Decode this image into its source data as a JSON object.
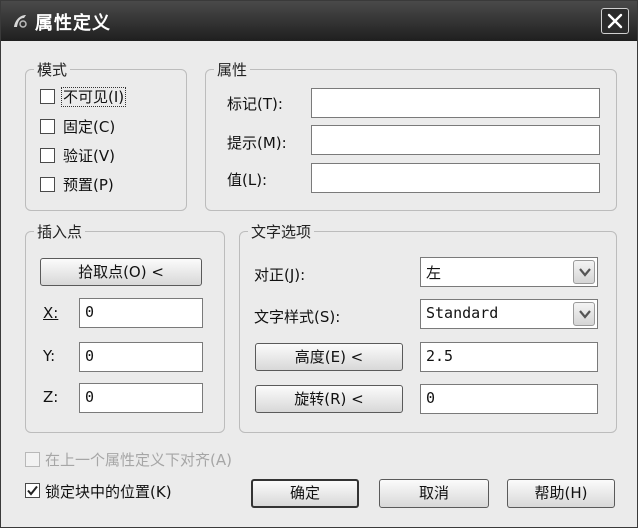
{
  "window": {
    "title": "属性定义"
  },
  "mode": {
    "legend": "模式",
    "items": [
      {
        "label": "不可见(I)",
        "checked": false
      },
      {
        "label": "固定(C)",
        "checked": false
      },
      {
        "label": "验证(V)",
        "checked": false
      },
      {
        "label": "预置(P)",
        "checked": false
      }
    ]
  },
  "attributes": {
    "legend": "属性",
    "tag_label": "标记(T):",
    "tag_value": "",
    "prompt_label": "提示(M):",
    "prompt_value": "",
    "value_label": "值(L):",
    "value_value": ""
  },
  "insert_point": {
    "legend": "插入点",
    "pick_button": "拾取点(O) <",
    "x_label": "X:",
    "x_value": "0",
    "y_label": "Y:",
    "y_value": "0",
    "z_label": "Z:",
    "z_value": "0"
  },
  "text_options": {
    "legend": "文字选项",
    "justify_label": "对正(J):",
    "justify_value": "左",
    "style_label": "文字样式(S):",
    "style_value": "Standard",
    "height_button": "高度(E) <",
    "height_value": "2.5",
    "rotation_button": "旋转(R) <",
    "rotation_value": "0"
  },
  "footer": {
    "align_below_label": "在上一个属性定义下对齐(A)",
    "align_below_enabled": false,
    "lock_position_label": "锁定块中的位置(K)",
    "lock_position_checked": true,
    "ok_button": "确定",
    "cancel_button": "取消",
    "help_button": "帮助(H)"
  }
}
